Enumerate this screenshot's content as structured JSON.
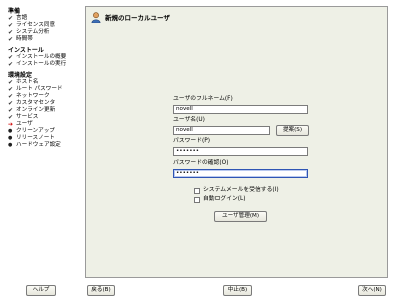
{
  "sidebar": {
    "sections": [
      {
        "title": "準備",
        "items": [
          {
            "label": "言語",
            "status": "done"
          },
          {
            "label": "ライセンス同意",
            "status": "done"
          },
          {
            "label": "システム分析",
            "status": "done"
          },
          {
            "label": "時間帯",
            "status": "done"
          }
        ]
      },
      {
        "title": "インストール",
        "items": [
          {
            "label": "インストールの概要",
            "status": "done"
          },
          {
            "label": "インストールの実行",
            "status": "done"
          }
        ]
      },
      {
        "title": "環境設定",
        "items": [
          {
            "label": "ホスト名",
            "status": "done"
          },
          {
            "label": "ルート パスワード",
            "status": "done"
          },
          {
            "label": "ネットワーク",
            "status": "done"
          },
          {
            "label": "カスタマセンタ",
            "status": "done"
          },
          {
            "label": "オンライン更新",
            "status": "done"
          },
          {
            "label": "サービス",
            "status": "done"
          },
          {
            "label": "ユーザ",
            "status": "current"
          },
          {
            "label": "クリーンアップ",
            "status": "pending"
          },
          {
            "label": "リリースノート",
            "status": "pending"
          },
          {
            "label": "ハードウェア設定",
            "status": "pending"
          }
        ]
      }
    ]
  },
  "dialog": {
    "title": "新規のローカルユーザ",
    "fullname": {
      "label": "ユーザのフルネーム(F)",
      "value": "novell"
    },
    "username": {
      "label": "ユーザ名(U)",
      "value": "novell"
    },
    "suggest_button": "提案(S)",
    "password": {
      "label": "パスワード(P)",
      "value": "•••••••"
    },
    "confirm": {
      "label": "パスワードの確認(O)",
      "value": "•••••••"
    },
    "receive_mail": {
      "label": "システムメールを受信する(I)",
      "checked": false
    },
    "auto_login": {
      "label": "自動ログイン(L)",
      "checked": false
    },
    "user_manage_button": "ユーザ管理(M)"
  },
  "footer": {
    "help": "ヘルプ",
    "back": "戻る(B)",
    "abort": "中止(B)",
    "next": "次へ(N)"
  },
  "icons": {
    "done": "check-icon",
    "current": "arrow-right-icon",
    "pending": "bullet-icon"
  }
}
